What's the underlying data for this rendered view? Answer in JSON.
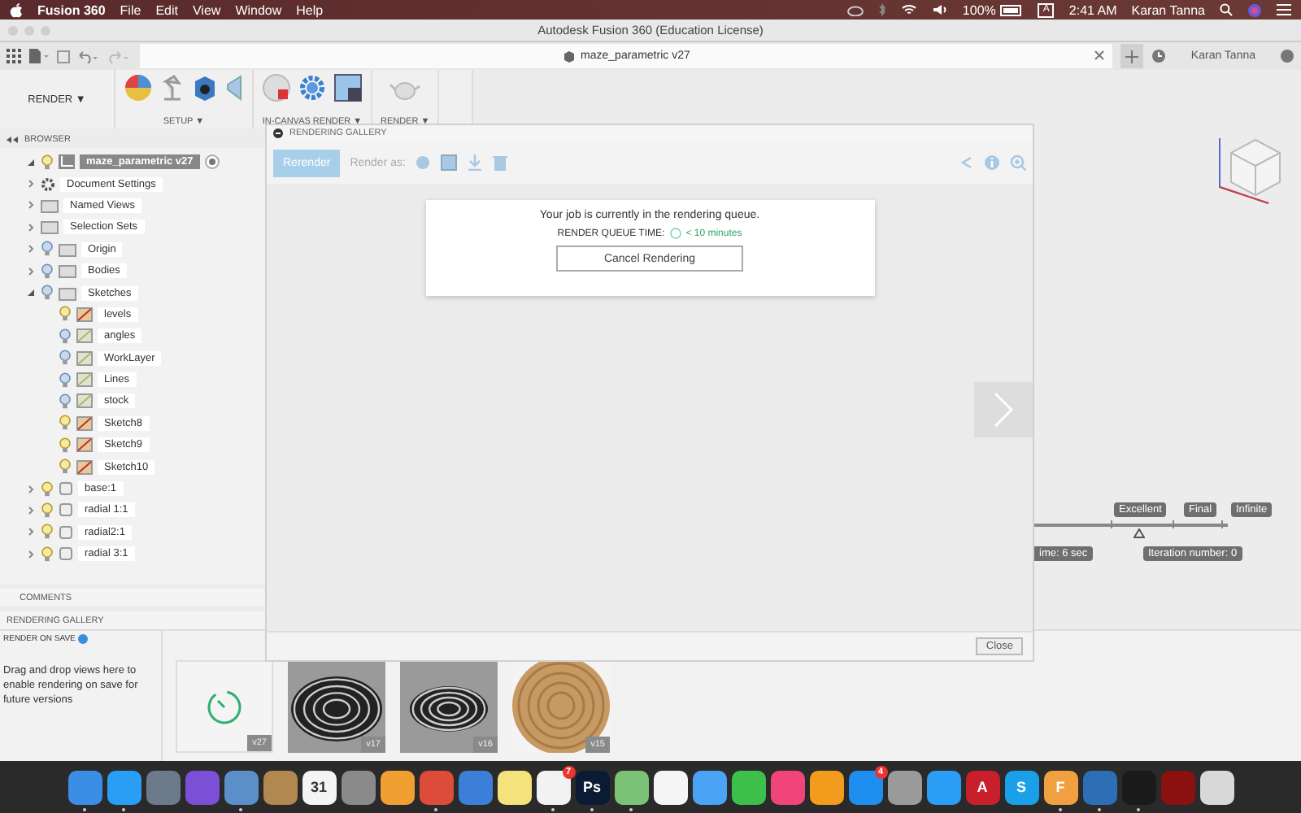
{
  "menubar": {
    "app": "Fusion 360",
    "menus": [
      "File",
      "Edit",
      "View",
      "Window",
      "Help"
    ],
    "battery": "100%",
    "input_source": "A",
    "clock": "2:41 AM",
    "user": "Karan Tanna"
  },
  "window": {
    "title": "Autodesk Fusion 360 (Education License)"
  },
  "tabbar": {
    "document_tab": "maze_parametric v27",
    "user": "Karan Tanna"
  },
  "toolbar": {
    "workspace": "RENDER ▼",
    "groups": [
      {
        "label": "SETUP ▼"
      },
      {
        "label": "IN-CANVAS RENDER ▼"
      },
      {
        "label": "RENDER ▼"
      }
    ]
  },
  "browser": {
    "title": "BROWSER",
    "tree": [
      {
        "label": "maze_parametric v27",
        "kind": "root",
        "expanded": true,
        "visible": true,
        "selected": true,
        "children": [
          {
            "label": "Document Settings",
            "kind": "settings",
            "expanded": false,
            "selected": false
          },
          {
            "label": "Named Views",
            "kind": "folder",
            "expanded": false,
            "selected": false
          },
          {
            "label": "Selection Sets",
            "kind": "folder",
            "expanded": false,
            "selected": false
          },
          {
            "label": "Origin",
            "kind": "folder",
            "expanded": false,
            "visible": false,
            "selected": false
          },
          {
            "label": "Bodies",
            "kind": "folder",
            "expanded": false,
            "visible": false,
            "selected": false
          },
          {
            "label": "Sketches",
            "kind": "folder",
            "expanded": true,
            "visible": false,
            "selected": false,
            "children": [
              {
                "label": "levels",
                "kind": "sketch",
                "visible": true,
                "selected": false
              },
              {
                "label": "angles",
                "kind": "sketch",
                "visible": false,
                "selected": false
              },
              {
                "label": "WorkLayer",
                "kind": "sketch",
                "visible": false,
                "selected": false
              },
              {
                "label": "Lines",
                "kind": "sketch",
                "visible": false,
                "selected": false
              },
              {
                "label": "stock",
                "kind": "sketch",
                "visible": false,
                "selected": false
              },
              {
                "label": "Sketch8",
                "kind": "sketch",
                "visible": true,
                "selected": false
              },
              {
                "label": "Sketch9",
                "kind": "sketch",
                "visible": true,
                "selected": false
              },
              {
                "label": "Sketch10",
                "kind": "sketch",
                "visible": true,
                "selected": false
              }
            ]
          },
          {
            "label": "base:1",
            "kind": "component",
            "expanded": false,
            "visible": true,
            "selected": false
          },
          {
            "label": "radial 1:1",
            "kind": "component",
            "expanded": false,
            "visible": true,
            "selected": false
          },
          {
            "label": "radial2:1",
            "kind": "component",
            "expanded": false,
            "visible": true,
            "selected": false
          },
          {
            "label": "radial 3:1",
            "kind": "component",
            "expanded": false,
            "visible": true,
            "selected": false
          }
        ]
      }
    ]
  },
  "comments": {
    "title": "COMMENTS"
  },
  "gallery_bar": {
    "title": "RENDERING GALLERY"
  },
  "render_on_save": {
    "title": "RENDER ON SAVE",
    "hint": "Drag and drop views here to enable rendering on save for future versions"
  },
  "thumbnails": [
    {
      "kind": "pending",
      "version": "v27"
    },
    {
      "kind": "picture",
      "version": "v17"
    },
    {
      "kind": "picture",
      "version": "v16"
    },
    {
      "kind": "picture",
      "version": "v15"
    }
  ],
  "viewport": {
    "quality_labels": [
      "Excellent",
      "Final",
      "Infinite"
    ],
    "quality": {
      "level": 0.55
    },
    "time": "ime: 6 sec",
    "iteration": "Iteration number: 0"
  },
  "gallery_panel": {
    "title": "RENDERING GALLERY",
    "rerender": "Rerender",
    "render_as": "Render as:",
    "message": "Your job is currently in the rendering queue.",
    "queue_label": "RENDER QUEUE TIME:",
    "queue_time": "< 10 minutes",
    "cancel": "Cancel Rendering",
    "close": "Close"
  },
  "dock": [
    {
      "color": "#3a8ee6",
      "running": true
    },
    {
      "color": "#2a9df4",
      "running": true
    },
    {
      "color": "#6c7a8c",
      "running": false
    },
    {
      "color": "#7b4fd6",
      "running": false
    },
    {
      "color": "#5b8fc7",
      "running": true
    },
    {
      "color": "#b08850",
      "running": false
    },
    {
      "color": "#f4f4f4",
      "label": "31",
      "running": false
    },
    {
      "color": "#8a8a8a",
      "running": false
    },
    {
      "color": "#f0a030",
      "running": false
    },
    {
      "color": "#dd4b39",
      "running": true
    },
    {
      "color": "#3c7fd8",
      "running": false
    },
    {
      "color": "#f6e27a",
      "running": false
    },
    {
      "color": "#f2f2f2",
      "badge": "7",
      "running": true
    },
    {
      "color": "#0b1b33",
      "label": "Ps",
      "running": true
    },
    {
      "color": "#7cc276",
      "running": true
    },
    {
      "color": "#f5f5f5",
      "running": false
    },
    {
      "color": "#4aa3f5",
      "running": false
    },
    {
      "color": "#3cc04a",
      "running": false
    },
    {
      "color": "#f0447a",
      "running": false
    },
    {
      "color": "#f39b1c",
      "running": false
    },
    {
      "color": "#1f8ef1",
      "badge": "4",
      "running": false
    },
    {
      "color": "#9a9a9a",
      "running": false
    },
    {
      "color": "#2a9df4",
      "running": false
    },
    {
      "color": "#c8202a",
      "label": "A",
      "running": false
    },
    {
      "color": "#1aa0e8",
      "label": "S",
      "running": false
    },
    {
      "color": "#f0a040",
      "label": "F",
      "running": true
    },
    {
      "color": "#2c6fb5",
      "running": true
    },
    {
      "color": "#1a1a1a",
      "running": true
    },
    {
      "color": "#8b1010",
      "running": false
    },
    {
      "color": "#d8d8d8",
      "running": false
    }
  ]
}
